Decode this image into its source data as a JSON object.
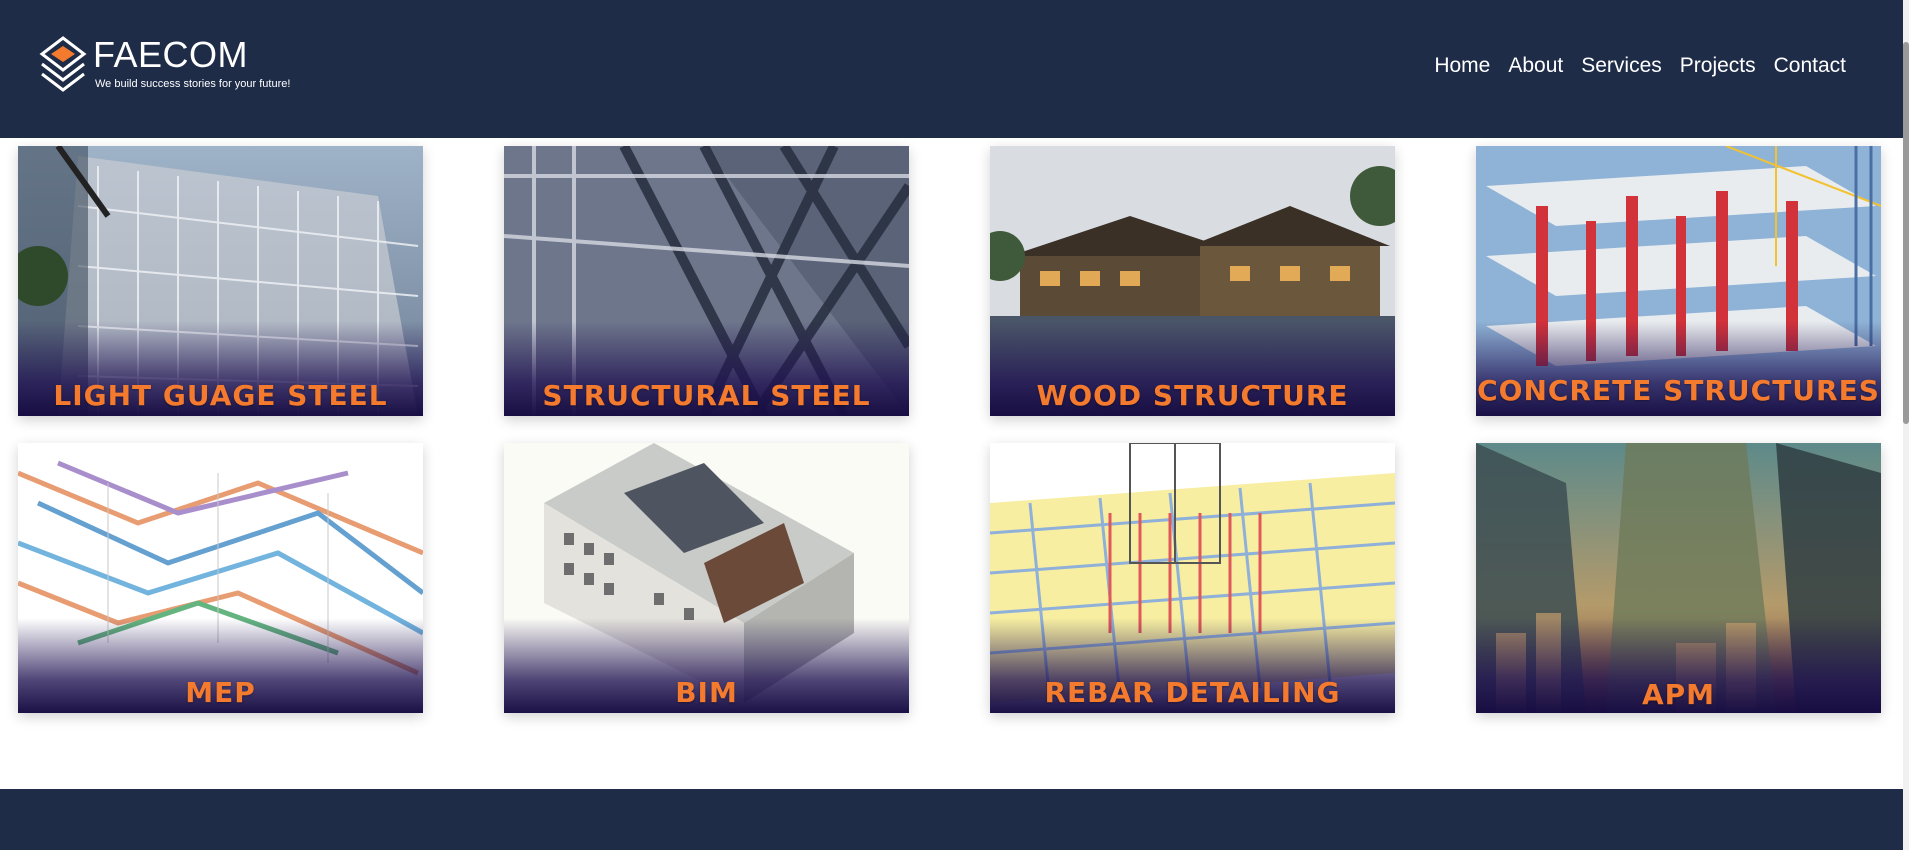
{
  "header": {
    "brand": "FAECOM",
    "tagline": "We build success stories for your future!",
    "nav": [
      "Home",
      "About",
      "Services",
      "Projects",
      "Contact"
    ]
  },
  "services": [
    {
      "label": "LIGHT GUAGE STEEL",
      "image": "light-gauge-steel-building"
    },
    {
      "label": "STRUCTURAL STEEL",
      "image": "steel-bridge-truss"
    },
    {
      "label": "WOOD STRUCTURE",
      "image": "wooden-resort-house"
    },
    {
      "label": "CONCRETE STRUCTURES",
      "image": "concrete-frame-construction"
    },
    {
      "label": "MEP",
      "image": "mep-piping-model"
    },
    {
      "label": "BIM",
      "image": "bim-building-model"
    },
    {
      "label": "REBAR DETAILING",
      "image": "rebar-cage-model"
    },
    {
      "label": "APM",
      "image": "city-skyscrapers"
    }
  ],
  "colors": {
    "header_bg": "#1e2c48",
    "label_orange": "#f47a2e",
    "card_gradient": "#201252"
  }
}
